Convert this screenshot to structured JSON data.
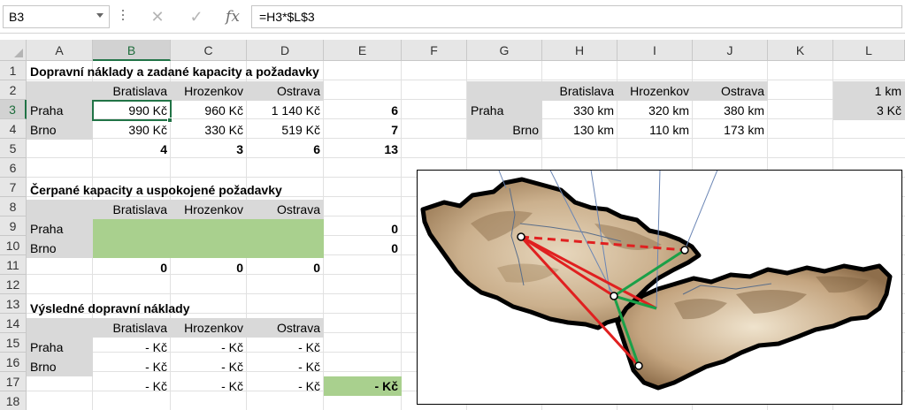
{
  "formula_bar": {
    "name_box": "B3",
    "cancel_icon": "✕",
    "enter_icon": "✓",
    "fx_label": "fx",
    "formula": "=H3*$L$3"
  },
  "columns": [
    "A",
    "B",
    "C",
    "D",
    "E",
    "F",
    "G",
    "H",
    "I",
    "J",
    "K",
    "L"
  ],
  "rows": [
    "1",
    "2",
    "3",
    "4",
    "5",
    "6",
    "7",
    "8",
    "9",
    "10",
    "11",
    "12",
    "13",
    "14",
    "15",
    "16",
    "17",
    "18"
  ],
  "sheet": {
    "title1": "Dopravní náklady a zadané kapacity a požadavky",
    "dest_headers": [
      "Bratislava",
      "Hrozenkov",
      "Ostrava"
    ],
    "src_praha": "Praha",
    "src_brno": "Brno",
    "costs_praha": [
      "990 Kč",
      "960 Kč",
      "1 140 Kč"
    ],
    "costs_brno": [
      "390 Kč",
      "330 Kč",
      "519 Kč"
    ],
    "capacity_praha": "6",
    "capacity_brno": "7",
    "demands": [
      "4",
      "3",
      "6"
    ],
    "total": "13",
    "title2": "Čerpané kapacity a uspokojené požadavky",
    "used_praha": "0",
    "used_brno": "0",
    "satisfied": [
      "0",
      "0",
      "0"
    ],
    "title3": "Výsledné dopravní náklady",
    "result_praha": [
      "- Kč",
      "- Kč",
      "- Kč"
    ],
    "result_brno": [
      "- Kč",
      "- Kč",
      "- Kč"
    ],
    "result_sums": [
      "- Kč",
      "- Kč",
      "- Kč"
    ],
    "result_total": "- Kč",
    "dist_headers": [
      "Bratislava",
      "Hrozenkov",
      "Ostrava"
    ],
    "dist_praha": [
      "330 km",
      "320 km",
      "380 km"
    ],
    "dist_brno": [
      "130 km",
      "110 km",
      "173 km"
    ],
    "unit_km": "1 km",
    "unit_price": "3 Kč"
  },
  "colors": {
    "accent": "#217346",
    "gray_fill": "#d9d9d9",
    "green_fill": "#a9d08e",
    "route_red": "#e02020",
    "route_green": "#1aa048"
  },
  "icons": {
    "map": "czechoslovakia-relief-map"
  }
}
